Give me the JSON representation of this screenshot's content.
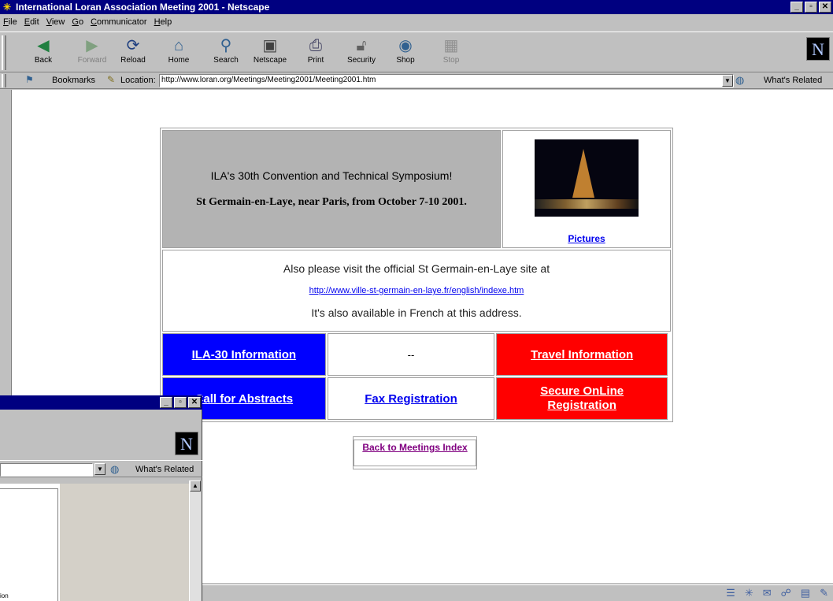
{
  "window": {
    "title": "International Loran Association Meeting 2001 - Netscape"
  },
  "menu": [
    "File",
    "Edit",
    "View",
    "Go",
    "Communicator",
    "Help"
  ],
  "toolbar": {
    "back": "Back",
    "forward": "Forward",
    "reload": "Reload",
    "home": "Home",
    "search": "Search",
    "netscape": "Netscape",
    "print": "Print",
    "security": "Security",
    "shop": "Shop",
    "stop": "Stop"
  },
  "locbar": {
    "bookmarks": "Bookmarks",
    "location_label": "Location:",
    "url": "http://www.loran.org/Meetings/Meeting2001/Meeting2001.htm",
    "whats_related": "What's Related"
  },
  "page": {
    "heading": "ILA's 30th Convention and Technical Symposium!",
    "subheading": "St Germain-en-Laye, near Paris, from October 7-10 2001.",
    "pictures_link": "Pictures",
    "visit_text": "Also please visit the official St Germain-en-Laye site at",
    "visit_url": "http://www.ville-st-germain-en-laye.fr/english/indexe.htm",
    "french_text": "It's also available in French at this address.",
    "ila30_info": "ILA-30 Information",
    "dash": "--",
    "travel_info": "Travel Information",
    "call_abstracts": "Call for Abstracts",
    "fax_registration": "Fax Registration",
    "secure_registration": "Secure OnLine Registration",
    "back_index": "Back to Meetings Index"
  },
  "window2": {
    "whats_related": "What's Related",
    "fragment": "ion"
  }
}
